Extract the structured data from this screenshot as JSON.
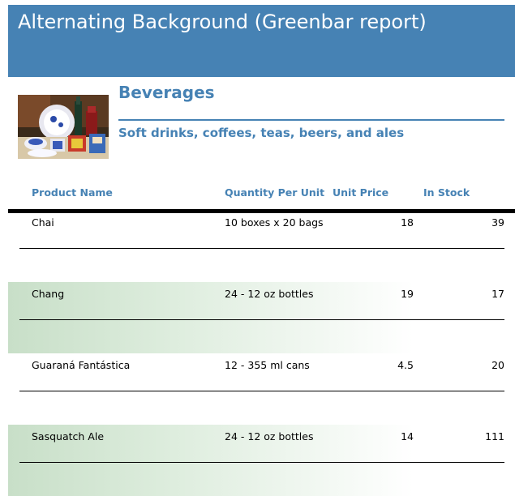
{
  "report": {
    "title": "Alternating Background (Greenbar report)"
  },
  "category": {
    "name": "Beverages",
    "description": "Soft drinks, coffees, teas, beers, and ales",
    "image_icon": "beverages-still-life-image"
  },
  "columns": {
    "product_name": "Product Name",
    "quantity_per_unit": "Quantity Per Unit",
    "unit_price": "Unit Price",
    "in_stock": "In Stock"
  },
  "products": [
    {
      "name": "Chai",
      "quantity": "10 boxes x 20 bags",
      "price": "18",
      "stock": "39"
    },
    {
      "name": "Chang",
      "quantity": "24 - 12 oz bottles",
      "price": "19",
      "stock": "17"
    },
    {
      "name": "Guaraná Fantástica",
      "quantity": "12 - 355 ml cans",
      "price": "4.5",
      "stock": "20"
    },
    {
      "name": "Sasquatch Ale",
      "quantity": "24 - 12 oz bottles",
      "price": "14",
      "stock": "111"
    }
  ],
  "colors": {
    "header_bg": "#4682b4",
    "accent": "#4682b4",
    "greenbar": "#c8dfc8"
  }
}
